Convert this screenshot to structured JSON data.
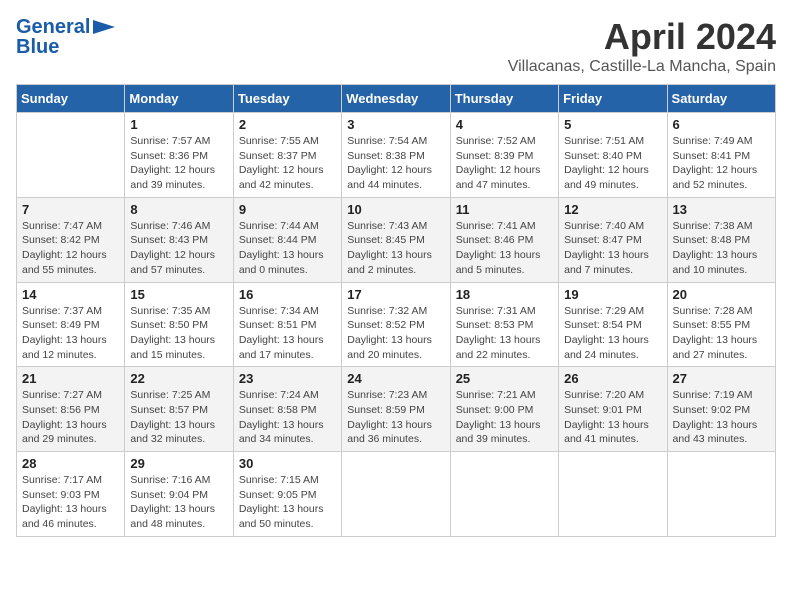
{
  "header": {
    "logo_line1": "General",
    "logo_line2": "Blue",
    "title": "April 2024",
    "subtitle": "Villacanas, Castille-La Mancha, Spain"
  },
  "days_of_week": [
    "Sunday",
    "Monday",
    "Tuesday",
    "Wednesday",
    "Thursday",
    "Friday",
    "Saturday"
  ],
  "weeks": [
    [
      {
        "day": "",
        "info": ""
      },
      {
        "day": "1",
        "info": "Sunrise: 7:57 AM\nSunset: 8:36 PM\nDaylight: 12 hours\nand 39 minutes."
      },
      {
        "day": "2",
        "info": "Sunrise: 7:55 AM\nSunset: 8:37 PM\nDaylight: 12 hours\nand 42 minutes."
      },
      {
        "day": "3",
        "info": "Sunrise: 7:54 AM\nSunset: 8:38 PM\nDaylight: 12 hours\nand 44 minutes."
      },
      {
        "day": "4",
        "info": "Sunrise: 7:52 AM\nSunset: 8:39 PM\nDaylight: 12 hours\nand 47 minutes."
      },
      {
        "day": "5",
        "info": "Sunrise: 7:51 AM\nSunset: 8:40 PM\nDaylight: 12 hours\nand 49 minutes."
      },
      {
        "day": "6",
        "info": "Sunrise: 7:49 AM\nSunset: 8:41 PM\nDaylight: 12 hours\nand 52 minutes."
      }
    ],
    [
      {
        "day": "7",
        "info": "Sunrise: 7:47 AM\nSunset: 8:42 PM\nDaylight: 12 hours\nand 55 minutes."
      },
      {
        "day": "8",
        "info": "Sunrise: 7:46 AM\nSunset: 8:43 PM\nDaylight: 12 hours\nand 57 minutes."
      },
      {
        "day": "9",
        "info": "Sunrise: 7:44 AM\nSunset: 8:44 PM\nDaylight: 13 hours\nand 0 minutes."
      },
      {
        "day": "10",
        "info": "Sunrise: 7:43 AM\nSunset: 8:45 PM\nDaylight: 13 hours\nand 2 minutes."
      },
      {
        "day": "11",
        "info": "Sunrise: 7:41 AM\nSunset: 8:46 PM\nDaylight: 13 hours\nand 5 minutes."
      },
      {
        "day": "12",
        "info": "Sunrise: 7:40 AM\nSunset: 8:47 PM\nDaylight: 13 hours\nand 7 minutes."
      },
      {
        "day": "13",
        "info": "Sunrise: 7:38 AM\nSunset: 8:48 PM\nDaylight: 13 hours\nand 10 minutes."
      }
    ],
    [
      {
        "day": "14",
        "info": "Sunrise: 7:37 AM\nSunset: 8:49 PM\nDaylight: 13 hours\nand 12 minutes."
      },
      {
        "day": "15",
        "info": "Sunrise: 7:35 AM\nSunset: 8:50 PM\nDaylight: 13 hours\nand 15 minutes."
      },
      {
        "day": "16",
        "info": "Sunrise: 7:34 AM\nSunset: 8:51 PM\nDaylight: 13 hours\nand 17 minutes."
      },
      {
        "day": "17",
        "info": "Sunrise: 7:32 AM\nSunset: 8:52 PM\nDaylight: 13 hours\nand 20 minutes."
      },
      {
        "day": "18",
        "info": "Sunrise: 7:31 AM\nSunset: 8:53 PM\nDaylight: 13 hours\nand 22 minutes."
      },
      {
        "day": "19",
        "info": "Sunrise: 7:29 AM\nSunset: 8:54 PM\nDaylight: 13 hours\nand 24 minutes."
      },
      {
        "day": "20",
        "info": "Sunrise: 7:28 AM\nSunset: 8:55 PM\nDaylight: 13 hours\nand 27 minutes."
      }
    ],
    [
      {
        "day": "21",
        "info": "Sunrise: 7:27 AM\nSunset: 8:56 PM\nDaylight: 13 hours\nand 29 minutes."
      },
      {
        "day": "22",
        "info": "Sunrise: 7:25 AM\nSunset: 8:57 PM\nDaylight: 13 hours\nand 32 minutes."
      },
      {
        "day": "23",
        "info": "Sunrise: 7:24 AM\nSunset: 8:58 PM\nDaylight: 13 hours\nand 34 minutes."
      },
      {
        "day": "24",
        "info": "Sunrise: 7:23 AM\nSunset: 8:59 PM\nDaylight: 13 hours\nand 36 minutes."
      },
      {
        "day": "25",
        "info": "Sunrise: 7:21 AM\nSunset: 9:00 PM\nDaylight: 13 hours\nand 39 minutes."
      },
      {
        "day": "26",
        "info": "Sunrise: 7:20 AM\nSunset: 9:01 PM\nDaylight: 13 hours\nand 41 minutes."
      },
      {
        "day": "27",
        "info": "Sunrise: 7:19 AM\nSunset: 9:02 PM\nDaylight: 13 hours\nand 43 minutes."
      }
    ],
    [
      {
        "day": "28",
        "info": "Sunrise: 7:17 AM\nSunset: 9:03 PM\nDaylight: 13 hours\nand 46 minutes."
      },
      {
        "day": "29",
        "info": "Sunrise: 7:16 AM\nSunset: 9:04 PM\nDaylight: 13 hours\nand 48 minutes."
      },
      {
        "day": "30",
        "info": "Sunrise: 7:15 AM\nSunset: 9:05 PM\nDaylight: 13 hours\nand 50 minutes."
      },
      {
        "day": "",
        "info": ""
      },
      {
        "day": "",
        "info": ""
      },
      {
        "day": "",
        "info": ""
      },
      {
        "day": "",
        "info": ""
      }
    ]
  ]
}
